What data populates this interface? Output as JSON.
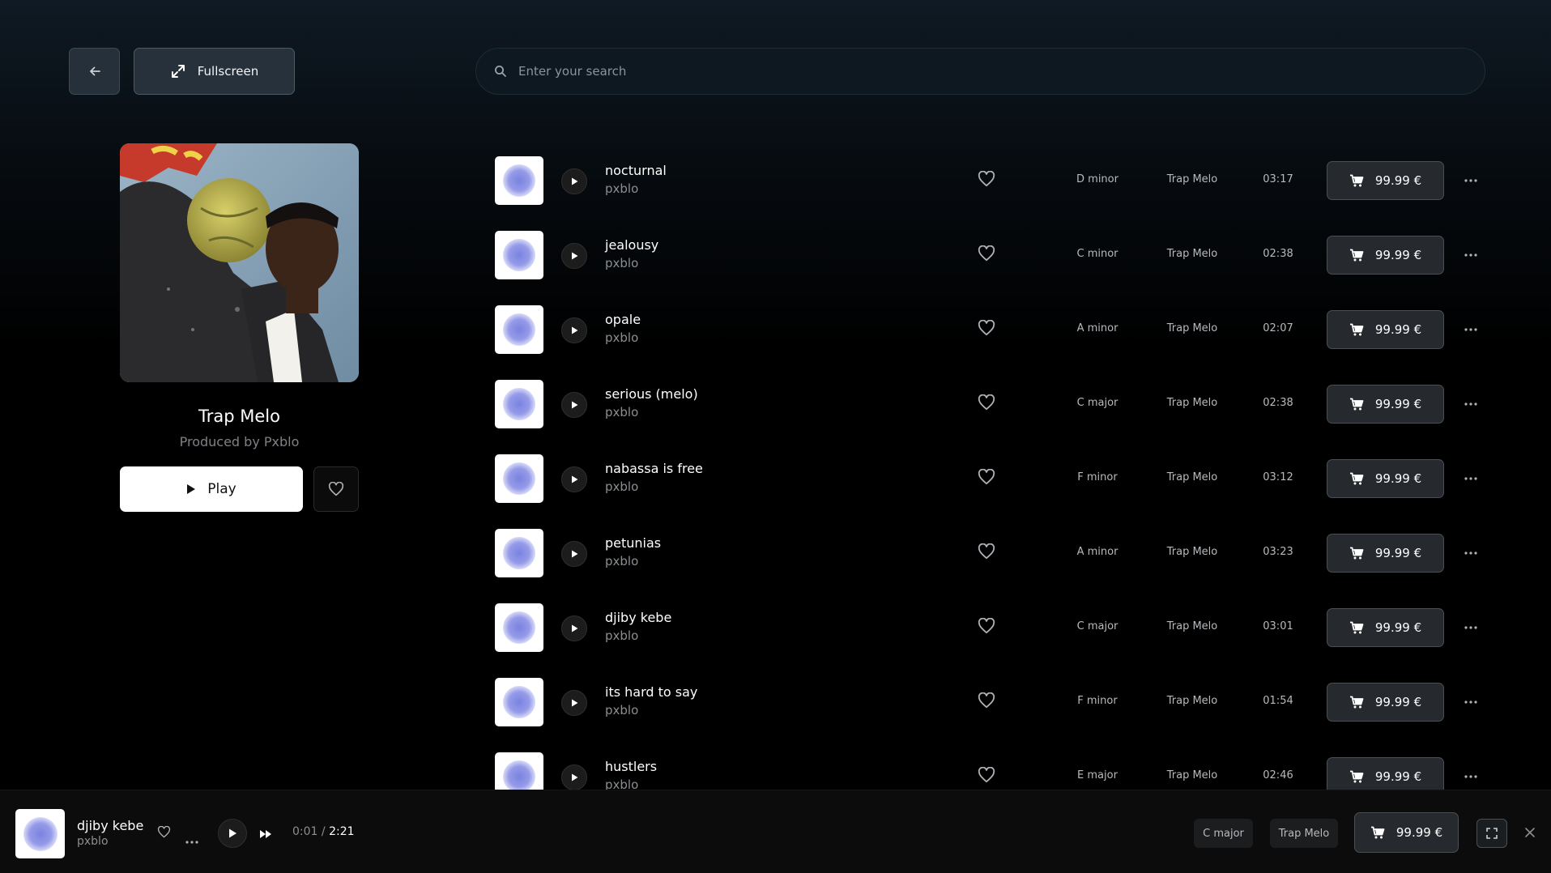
{
  "header": {
    "fullscreen_label": "Fullscreen",
    "search_placeholder": "Enter your search"
  },
  "album": {
    "title": "Trap Melo",
    "subtitle": "Produced by Pxblo",
    "play_label": "Play"
  },
  "tracks": [
    {
      "title": "nocturnal",
      "artist": "pxblo",
      "key": "D minor",
      "genre": "Trap Melo",
      "duration": "03:17",
      "price": "99.99 €"
    },
    {
      "title": "jealousy",
      "artist": "pxblo",
      "key": "C minor",
      "genre": "Trap Melo",
      "duration": "02:38",
      "price": "99.99 €"
    },
    {
      "title": "opale",
      "artist": "pxblo",
      "key": "A minor",
      "genre": "Trap Melo",
      "duration": "02:07",
      "price": "99.99 €"
    },
    {
      "title": "serious (melo)",
      "artist": "pxblo",
      "key": "C major",
      "genre": "Trap Melo",
      "duration": "02:38",
      "price": "99.99 €"
    },
    {
      "title": "nabassa is free",
      "artist": "pxblo",
      "key": "F minor",
      "genre": "Trap Melo",
      "duration": "03:12",
      "price": "99.99 €"
    },
    {
      "title": "petunias",
      "artist": "pxblo",
      "key": "A minor",
      "genre": "Trap Melo",
      "duration": "03:23",
      "price": "99.99 €"
    },
    {
      "title": "djiby kebe",
      "artist": "pxblo",
      "key": "C major",
      "genre": "Trap Melo",
      "duration": "03:01",
      "price": "99.99 €"
    },
    {
      "title": "its hard to say",
      "artist": "pxblo",
      "key": "F minor",
      "genre": "Trap Melo",
      "duration": "01:54",
      "price": "99.99 €"
    },
    {
      "title": "hustlers",
      "artist": "pxblo",
      "key": "E major",
      "genre": "Trap Melo",
      "duration": "02:46",
      "price": "99.99 €"
    }
  ],
  "player": {
    "title": "djiby kebe",
    "artist": "pxblo",
    "current_time": "0:01",
    "separator": " / ",
    "total_time": "2:21",
    "key": "C major",
    "genre": "Trap Melo",
    "price": "99.99 €"
  },
  "icons": {
    "back": "arrow-left-icon",
    "fullscreen": "expand-icon",
    "search": "search-icon",
    "play": "play-icon",
    "heart": "heart-icon",
    "cart": "cart-icon",
    "more": "more-horizontal-icon",
    "next": "fast-forward-icon",
    "close": "close-icon"
  },
  "colors": {
    "background": "#000000",
    "header_gradient": "#0f1a24",
    "button_surface": "#262a2e",
    "thumb_blob": "#7b82e0"
  }
}
